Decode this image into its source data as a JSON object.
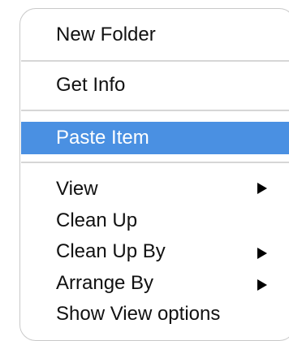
{
  "menu": {
    "items": [
      {
        "label": "New Folder"
      },
      {
        "label": "Get Info"
      },
      {
        "label": "Paste Item",
        "selected": true
      },
      {
        "label": "View",
        "has_submenu": true
      },
      {
        "label": "Clean Up"
      },
      {
        "label": "Clean Up By",
        "has_submenu": true
      },
      {
        "label": "Arrange By",
        "has_submenu": true
      },
      {
        "label": "Show View options"
      }
    ]
  },
  "colors": {
    "highlight": "#4a90e2",
    "separator": "#d6d6d6",
    "border": "#c9c9c9"
  },
  "icons": {
    "submenu": "submenu-arrow-icon"
  }
}
